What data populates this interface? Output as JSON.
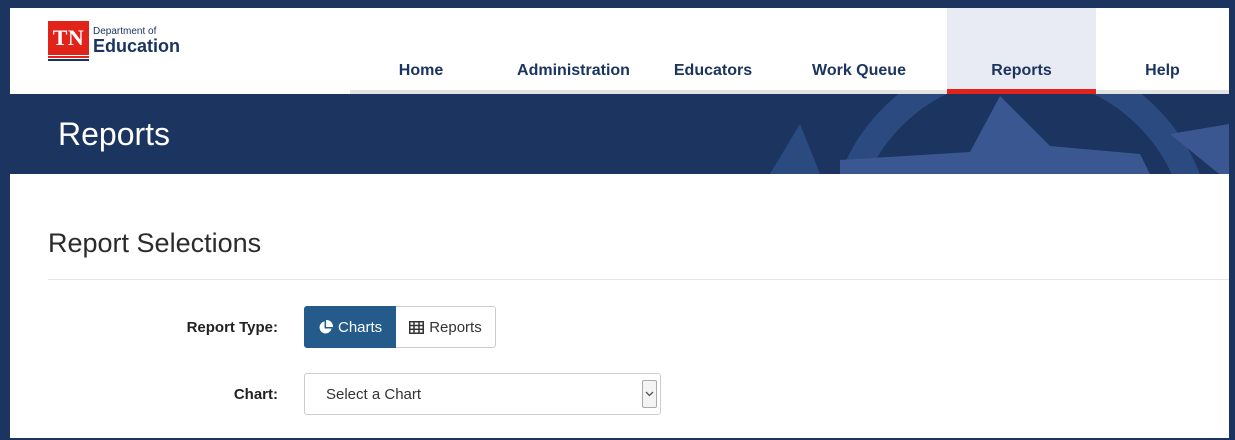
{
  "logo": {
    "badge": "TN",
    "dept_line": "Department of",
    "name_line": "Education"
  },
  "nav": {
    "items": [
      {
        "label": "Home",
        "active": false
      },
      {
        "label": "Administration",
        "active": false
      },
      {
        "label": "Educators",
        "active": false
      },
      {
        "label": "Work Queue",
        "active": false
      },
      {
        "label": "Reports",
        "active": true
      },
      {
        "label": "Help",
        "active": false
      }
    ]
  },
  "banner": {
    "title": "Reports"
  },
  "selections": {
    "title": "Report Selections",
    "report_type_label": "Report Type:",
    "report_type_options": [
      {
        "label": "Charts",
        "icon": "pie-chart-icon",
        "active": true
      },
      {
        "label": "Reports",
        "icon": "table-icon",
        "active": false
      }
    ],
    "chart_label": "Chart:",
    "chart_select_value": "Select a Chart"
  },
  "colors": {
    "navy": "#1b3560",
    "accent_red": "#e2231a",
    "active_button": "#245b8a"
  }
}
